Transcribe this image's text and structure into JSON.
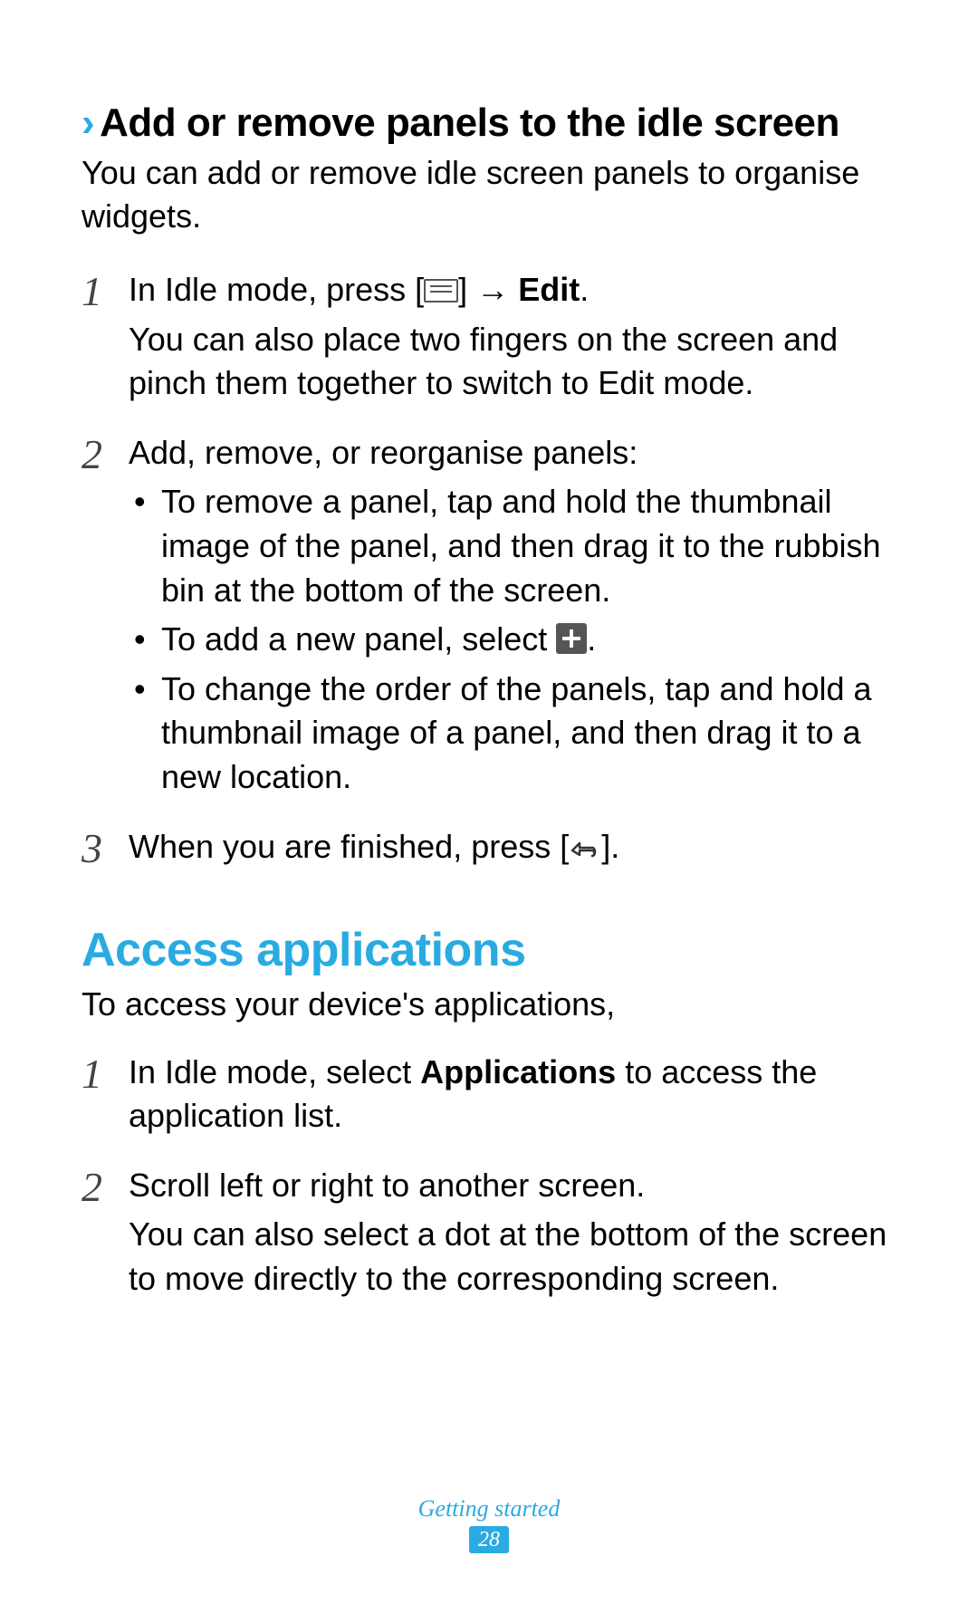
{
  "subsection": {
    "title": "Add or remove panels to the idle screen",
    "intro": "You can add or remove idle screen panels to organise widgets."
  },
  "steps_a": [
    {
      "num": "1",
      "line1_pre": "In Idle mode, press [",
      "line1_mid": "] → ",
      "line1_bold": "Edit",
      "line1_post": ".",
      "line2": "You can also place two fingers on the screen and pinch them together to switch to Edit mode."
    },
    {
      "num": "2",
      "line1": "Add, remove, or reorganise panels:",
      "bullets": [
        "To remove a panel, tap and hold the thumbnail image of the panel, and then drag it to the rubbish bin at the bottom of the screen.",
        "To add a new panel, select ",
        "To change the order of the panels, tap and hold a thumbnail image of a panel, and then drag it to a new location."
      ],
      "bullet2_post": "."
    },
    {
      "num": "3",
      "line1_pre": "When you are finished, press [",
      "line1_post": "]."
    }
  ],
  "section2": {
    "title": "Access applications",
    "intro": "To access your device's applications,"
  },
  "steps_b": [
    {
      "num": "1",
      "pre": "In Idle mode, select ",
      "bold": "Applications",
      "post": " to access the application list."
    },
    {
      "num": "2",
      "line1": "Scroll left or right to another screen.",
      "line2": "You can also select a dot at the bottom of the screen to move directly to the corresponding screen."
    }
  ],
  "footer": {
    "section": "Getting started",
    "page": "28"
  }
}
